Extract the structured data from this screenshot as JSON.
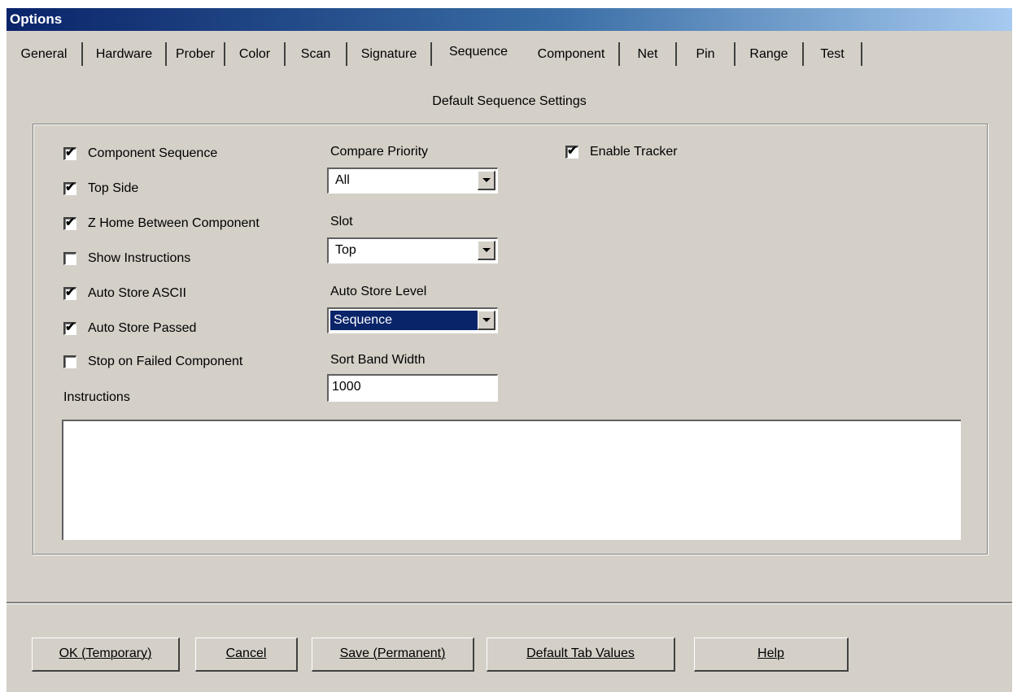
{
  "window": {
    "title": "Options"
  },
  "tabs": [
    {
      "label": "General"
    },
    {
      "label": "Hardware"
    },
    {
      "label": "Prober"
    },
    {
      "label": "Color"
    },
    {
      "label": "Scan"
    },
    {
      "label": "Signature"
    },
    {
      "label": "Sequence",
      "active": true
    },
    {
      "label": "Component"
    },
    {
      "label": "Net"
    },
    {
      "label": "Pin"
    },
    {
      "label": "Range"
    },
    {
      "label": "Test"
    }
  ],
  "panel": {
    "heading": "Default Sequence Settings",
    "checkboxes": {
      "component_sequence": {
        "label": "Component Sequence",
        "checked": true
      },
      "top_side": {
        "label": "Top Side",
        "checked": true
      },
      "z_home": {
        "label": "Z Home Between Component",
        "checked": true
      },
      "show_instructions": {
        "label": "Show Instructions",
        "checked": false
      },
      "auto_store_ascii": {
        "label": "Auto Store ASCII",
        "checked": true
      },
      "auto_store_passed": {
        "label": "Auto Store Passed",
        "checked": true
      },
      "stop_on_failed": {
        "label": "Stop on Failed Component",
        "checked": false
      },
      "enable_tracker": {
        "label": "Enable Tracker",
        "checked": true
      }
    },
    "compare_priority": {
      "label": "Compare Priority",
      "value": "All"
    },
    "slot": {
      "label": "Slot",
      "value": "Top"
    },
    "auto_store_level": {
      "label": "Auto Store Level",
      "value": "Sequence"
    },
    "sort_band_width": {
      "label": "Sort Band Width",
      "value": "1000"
    },
    "instructions": {
      "label": "Instructions",
      "value": ""
    }
  },
  "buttons": {
    "ok": "OK (Temporary)",
    "cancel": "Cancel",
    "save": "Save (Permanent)",
    "default": "Default Tab Values",
    "help": "Help"
  },
  "icons": {
    "check": "✔",
    "dropdown": "chevron-down-icon"
  }
}
